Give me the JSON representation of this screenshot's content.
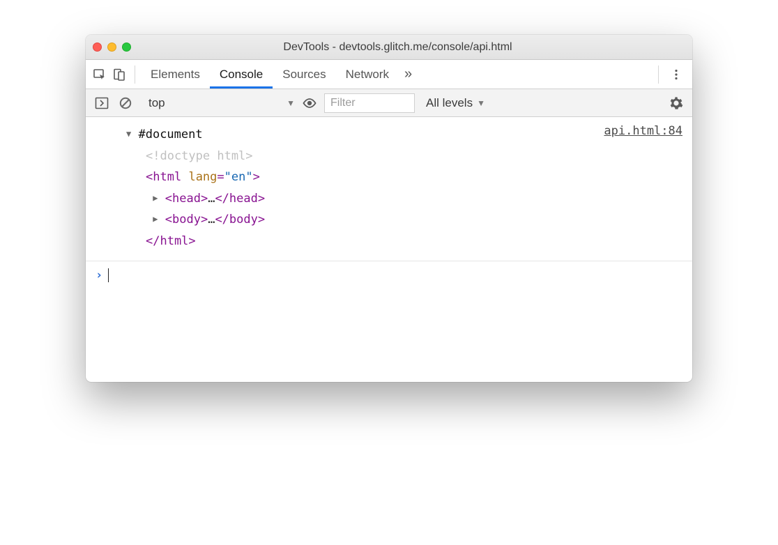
{
  "window": {
    "title": "DevTools - devtools.glitch.me/console/api.html"
  },
  "tabs": {
    "items": [
      "Elements",
      "Console",
      "Sources",
      "Network"
    ],
    "active_index": 1,
    "overflow_glyph": "»"
  },
  "toolbar": {
    "context": "top",
    "filter_placeholder": "Filter",
    "levels_label": "All levels"
  },
  "console": {
    "source_link": "api.html:84",
    "root_label": "#document",
    "doctype": "<!doctype html>",
    "html_open_tag": "html",
    "html_attr_name": "lang",
    "html_attr_value": "\"en\"",
    "head_tag": "head",
    "body_tag": "body",
    "ellipsis": "…",
    "html_close": "</html>",
    "prompt_glyph": "›"
  }
}
